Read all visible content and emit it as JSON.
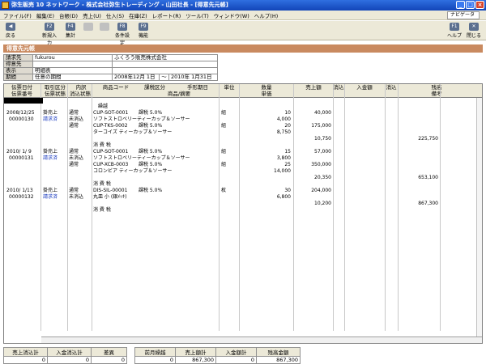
{
  "window": {
    "title": "弥生販売 10 ネットワーク - 株式会社弥生トレーディング - 山田社長 - [得意先元帳]"
  },
  "menu": [
    "ファイル(F)",
    "編集(E)",
    "台帳(D)",
    "売上(U)",
    "仕入(S)",
    "在庫(Z)",
    "レポート(R)",
    "ツール(T)",
    "ウィンドウ(W)",
    "ヘルプ(H)"
  ],
  "navigator": "ナビゲータ",
  "toolbar": {
    "back": "戻る",
    "new": "新規入力",
    "total": "集計",
    "cond": "条件設定",
    "func": "機能",
    "help": "ヘルプ",
    "close": "閉じる",
    "keys": {
      "new": "F2",
      "total": "F4",
      "cond": "F8",
      "func": "F9",
      "help": "F1"
    }
  },
  "page_title": "得意先元帳",
  "info": {
    "billing_label": "請求先",
    "billing_code": "fukurou",
    "billing_name": "ふくろう販売株式会社",
    "customer_label": "得意先",
    "display_label": "表示",
    "display_value": "明細表",
    "period_label": "期間",
    "period_type": "任意の期間",
    "period_from": "2008年12月 1日",
    "period_sep": "～",
    "period_to": "2010年 1月31日"
  },
  "columns": {
    "date": "伝票日付",
    "slip_no": "伝票番号",
    "deal": "取引区分",
    "slip_status": "伝票状態",
    "detail": "内訳",
    "tax_status": "消込状態",
    "product_code": "商品コード",
    "product_name": "商品/摘要",
    "tax": "課税区分",
    "bill_date": "手形期日",
    "unit": "単位",
    "qty": "数量",
    "unit_price": "単価",
    "sales": "売上額",
    "clear1": "消込",
    "payment": "入金額",
    "clear2": "消込",
    "balance": "残高",
    "note": "備考"
  },
  "rows": [
    {
      "name": "繰越"
    },
    {
      "date": "2008/12/25",
      "deal": "掛売上",
      "detail": "通常",
      "code": "CUP-SOT-0001",
      "tax": "課税 5.0%",
      "unit": "組",
      "qty": "10",
      "sales": "40,000"
    },
    {
      "slipno": "00000130",
      "status": "請求済",
      "taxstat": "未消込",
      "name": "ソフトストロベリーティーカップ＆ソーサー",
      "price": "4,000"
    },
    {
      "detail": "通常",
      "code": "CUP-TKS-0002",
      "tax": "課税 5.0%",
      "unit": "組",
      "qty": "20",
      "sales": "175,000"
    },
    {
      "name": "ターコイズ ティーカップ＆ソーサー",
      "price": "8,750"
    },
    {
      "sales": "10,750",
      "balance": "225,750"
    },
    {
      "name": "消 費 税"
    },
    {
      "date": "2010/ 1/ 9",
      "deal": "掛売上",
      "detail": "通常",
      "code": "CUP-SOT-0001",
      "tax": "課税 5.0%",
      "unit": "組",
      "qty": "15",
      "sales": "57,000"
    },
    {
      "slipno": "00000131",
      "status": "請求済",
      "taxstat": "未消込",
      "name": "ソフトストロベリーティーカップ＆ソーサー",
      "price": "3,800"
    },
    {
      "detail": "通常",
      "code": "CUP-XCB-0003",
      "tax": "課税 5.0%",
      "unit": "組",
      "qty": "25",
      "sales": "350,000"
    },
    {
      "name": "コロンビア ティーカップ＆ソーサー",
      "price": "14,000"
    },
    {
      "sales": "20,350",
      "balance": "653,100"
    },
    {
      "name": "消 費 税"
    },
    {
      "date": "2010/ 1/13",
      "deal": "掛売上",
      "detail": "通常",
      "code": "DIS-SIL-00001",
      "tax": "課税 5.0%",
      "unit": "枚",
      "qty": "30",
      "sales": "204,000"
    },
    {
      "slipno": "00000132",
      "status": "請求済",
      "taxstat": "未消込",
      "name": "丸皿 小 (銀ﾒｯｷ)",
      "price": "6,800"
    },
    {
      "sales": "10,200",
      "balance": "867,300"
    },
    {
      "name": "消 費 税"
    }
  ],
  "footer_left": {
    "h1": "売上消込計",
    "h2": "入金消込計",
    "h3": "差異",
    "v1": "0",
    "v2": "0",
    "v3": "0"
  },
  "footer_right": {
    "h1": "前月繰越",
    "h2": "売上額計",
    "h3": "入金額計",
    "h4": "残高金額",
    "v1": "0",
    "v2": "867,300",
    "v3": "0",
    "v4": "867,300"
  }
}
